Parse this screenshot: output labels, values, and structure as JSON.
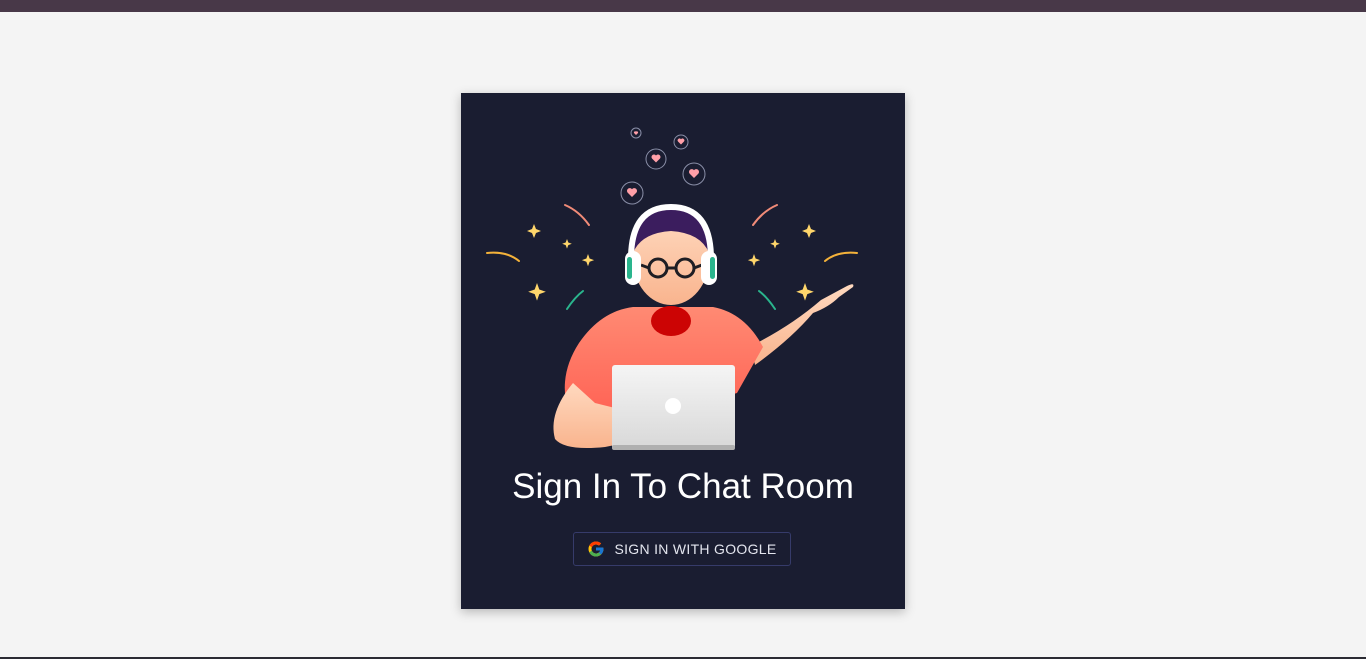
{
  "page": {
    "background": "#f4f4f4",
    "topbar_color": "#483848"
  },
  "card": {
    "background": "#1a1d31",
    "title": "Sign In To Chat Room",
    "illustration_icon": "person-with-headphones-and-laptop-illustration"
  },
  "signin": {
    "button_label": "SIGN IN WITH GOOGLE",
    "icon": "google-g-icon",
    "border_color": "#363b6a"
  }
}
